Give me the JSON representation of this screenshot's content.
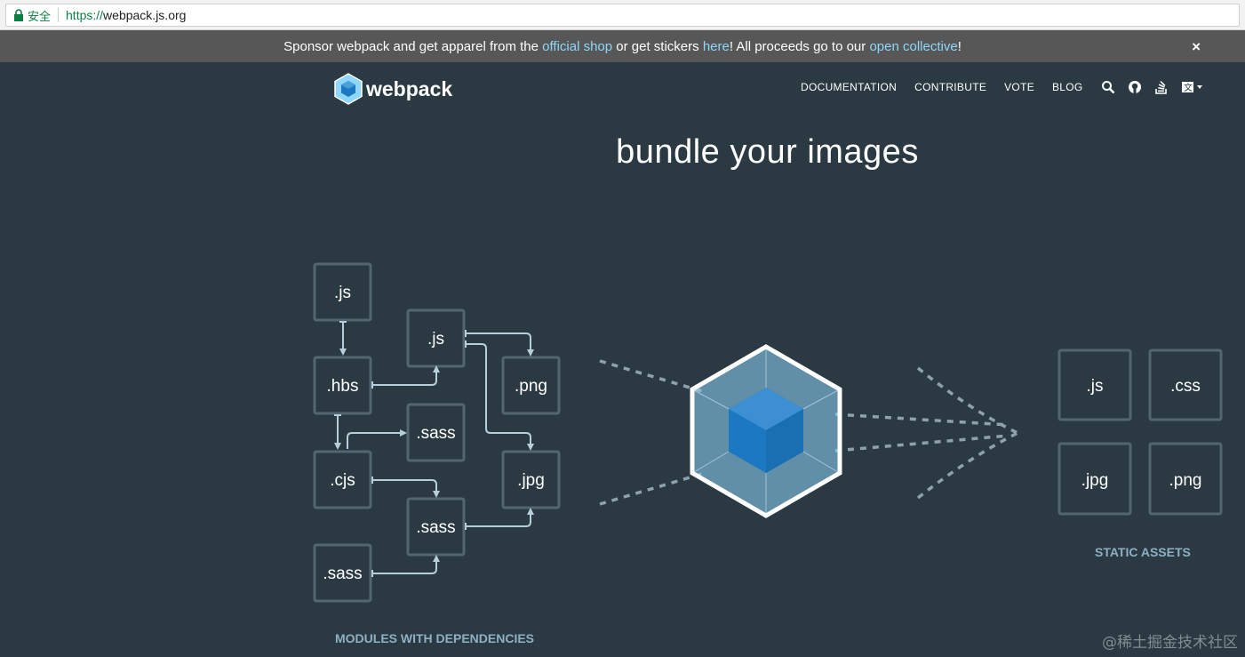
{
  "browser": {
    "security_label": "安全",
    "url_scheme": "https://",
    "url_host": "webpack.js.org"
  },
  "sponsor": {
    "text_1": "Sponsor webpack and get apparel from the ",
    "link_shop": "official shop",
    "text_2": " or get stickers ",
    "link_here": "here",
    "text_3": "! All proceeds go to our ",
    "link_collective": "open collective",
    "text_4": "!",
    "close": "×",
    "link_color": "#8dd6f9"
  },
  "nav": {
    "brand": "webpack",
    "links": [
      "DOCUMENTATION",
      "CONTRIBUTE",
      "VOTE",
      "BLOG"
    ],
    "icons": [
      "search-icon",
      "github-icon",
      "stackoverflow-icon",
      "language-icon"
    ]
  },
  "hero": {
    "headline": "bundle your images"
  },
  "modules": {
    "boxes": [
      ".js",
      ".js",
      ".png",
      ".hbs",
      ".sass",
      ".jpg",
      ".cjs",
      ".sass",
      ".sass"
    ],
    "caption": "MODULES WITH DEPENDENCIES"
  },
  "assets": {
    "boxes": [
      ".js",
      ".css",
      ".jpg",
      ".png"
    ],
    "caption": "STATIC ASSETS"
  },
  "colors": {
    "background": "#2b3a42",
    "box_border": "#53656f",
    "arrow": "#b6cfdd",
    "cube_light": "#8ed6fb",
    "cube_dark": "#1c78c0"
  },
  "watermark": "@稀土掘金技术社区"
}
